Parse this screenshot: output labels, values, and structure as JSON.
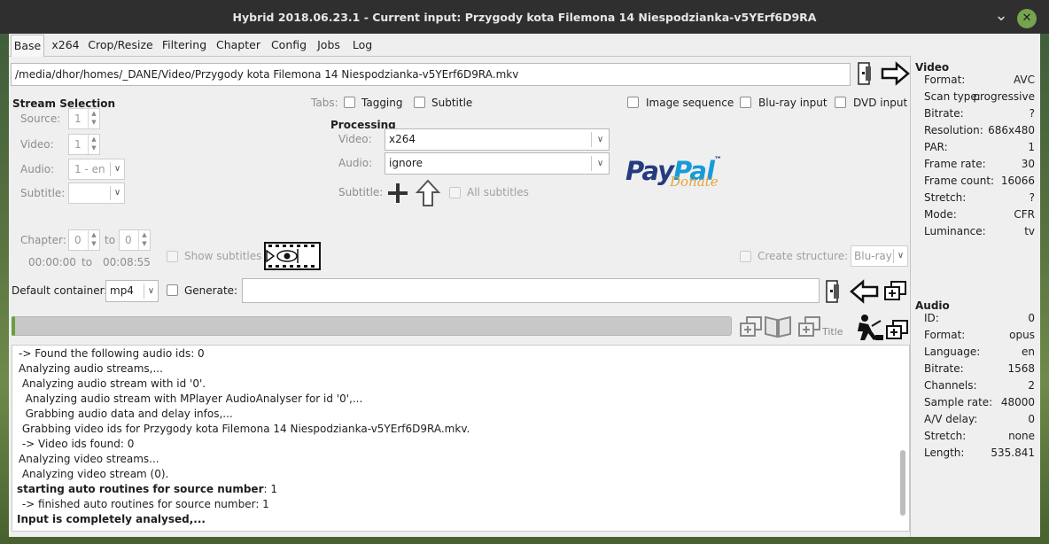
{
  "window": {
    "title": "Hybrid 2018.06.23.1 - Current input: Przygody kota Filemona 14 Niespodzianka-v5YErf6D9RA",
    "minimize_glyph": "⌄",
    "close_glyph": "✕"
  },
  "tabs": [
    "Base",
    "x264",
    "Crop/Resize",
    "Filtering",
    "Chapter",
    "Config",
    "Jobs",
    "Log"
  ],
  "input_path": "/media/dhor/homes/_DANE/Video/Przygody kota Filemona 14 Niespodzianka-v5YErf6D9RA.mkv",
  "stream_selection": {
    "title": "Stream Selection",
    "source_label": "Source:",
    "source_value": "1",
    "video_label": "Video:",
    "video_value": "1",
    "audio_label": "Audio:",
    "audio_value": "1 - en",
    "subtitle_label": "Subtitle:",
    "subtitle_value": ""
  },
  "tabs_row": {
    "label": "Tabs:",
    "tagging": "Tagging",
    "subtitle": "Subtitle",
    "image_sequence": "Image sequence",
    "bluray_input": "Blu-ray input",
    "dvd_input": "DVD input"
  },
  "processing": {
    "title": "Processing",
    "video_label": "Video:",
    "video_value": "x264",
    "audio_label": "Audio:",
    "audio_value": "ignore",
    "subtitle_label": "Subtitle:",
    "all_subtitles": "All subtitles"
  },
  "paypal": {
    "pay": "Pay",
    "pal": "Pal",
    "tm": "™",
    "donate": "Donate"
  },
  "chapter": {
    "label": "Chapter:",
    "from": "0",
    "to_label": "to",
    "to": "0",
    "time_from": "00:00:00",
    "time_to_label": "to",
    "time_to": "00:08:55",
    "show_subtitles": "Show subtitles"
  },
  "structure": {
    "label": "Create structure:",
    "value": "Blu-ray"
  },
  "output": {
    "default_container_label": "Default container:",
    "container_value": "mp4",
    "generate_label": "Generate:",
    "generate_value": ""
  },
  "toolbar": {
    "title_label": "Title"
  },
  "log_lines": [
    {
      "text": "-> Found the following audio ids: 0",
      "bold": false
    },
    {
      "text": "Analyzing audio streams,...",
      "bold": false
    },
    {
      "text": " Analyzing audio stream with id '0'.",
      "bold": false
    },
    {
      "text": "  Analyzing audio stream with MPlayer AudioAnalyser for id '0',...",
      "bold": false
    },
    {
      "text": "  Grabbing audio data and delay infos,...",
      "bold": false
    },
    {
      "text": " Grabbing video ids for Przygody kota Filemona 14 Niespodzianka-v5YErf6D9RA.mkv.",
      "bold": false
    },
    {
      "text": " -> Video ids found: 0",
      "bold": false
    },
    {
      "text": "Analyzing video streams...",
      "bold": false
    },
    {
      "text": " Analyzing video stream (0).",
      "bold": false
    },
    {
      "text": "starting auto routines for source number: 1",
      "bold": "partial",
      "bold_part": "starting auto routines for source number",
      "rest": ": 1"
    },
    {
      "text": " -> finished auto routines for source number: 1",
      "bold": false
    },
    {
      "text": "Input is completely analysed,...",
      "bold": true
    }
  ],
  "video_info": {
    "title": "Video",
    "rows": [
      {
        "k": "Format:",
        "v": "AVC"
      },
      {
        "k": "Scan type:",
        "v": "progressive"
      },
      {
        "k": "Bitrate:",
        "v": "?"
      },
      {
        "k": "Resolution:",
        "v": "686x480"
      },
      {
        "k": "PAR:",
        "v": "1"
      },
      {
        "k": "Frame rate:",
        "v": "30"
      },
      {
        "k": "Frame count:",
        "v": "16066"
      },
      {
        "k": "Stretch:",
        "v": "?"
      },
      {
        "k": "Mode:",
        "v": "CFR"
      },
      {
        "k": "Luminance:",
        "v": "tv"
      }
    ]
  },
  "audio_info": {
    "title": "Audio",
    "rows": [
      {
        "k": "ID:",
        "v": "0"
      },
      {
        "k": "Format:",
        "v": "opus"
      },
      {
        "k": "Language:",
        "v": "en"
      },
      {
        "k": "Bitrate:",
        "v": "1568"
      },
      {
        "k": "Channels:",
        "v": "2"
      },
      {
        "k": "Sample rate:",
        "v": "48000"
      },
      {
        "k": "A/V delay:",
        "v": "0"
      },
      {
        "k": "Stretch:",
        "v": "none"
      },
      {
        "k": "Length:",
        "v": "535.841"
      }
    ]
  },
  "progress": {
    "fraction": 0.0
  },
  "colors": {
    "paypal_dark": "#253b80",
    "paypal_light": "#179bd7",
    "donate": "#e8a23a",
    "accent_close": "#76a34d"
  }
}
